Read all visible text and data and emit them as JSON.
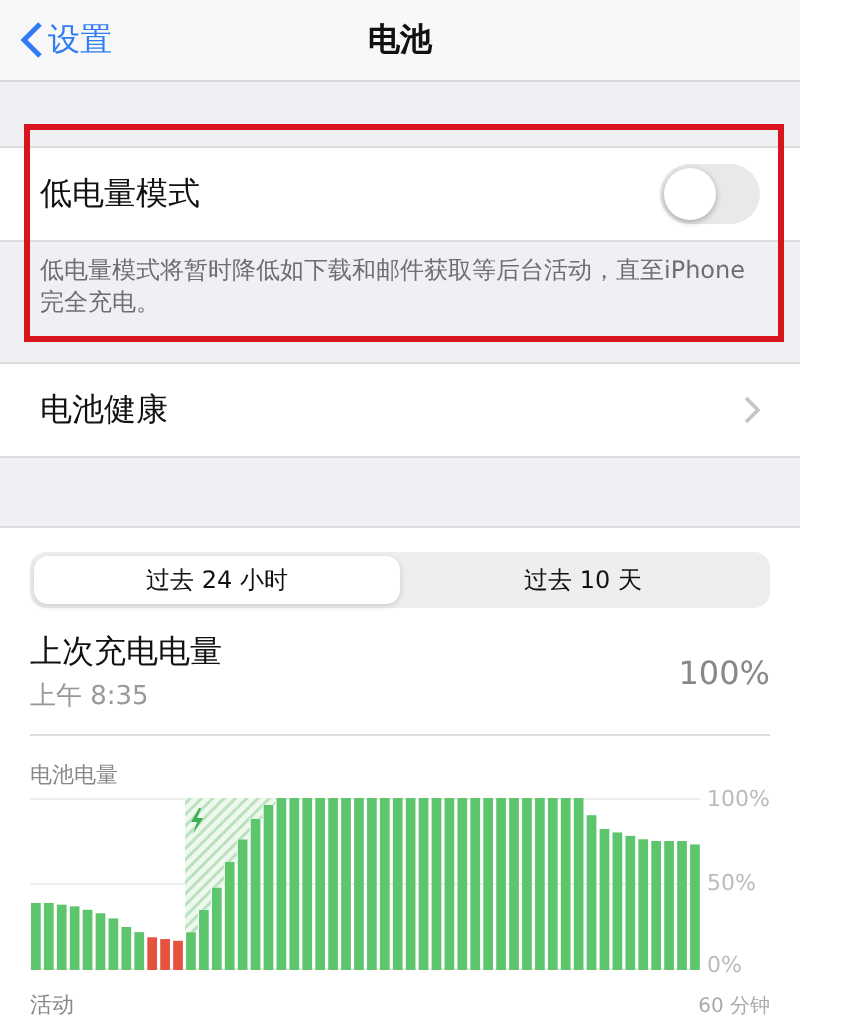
{
  "nav": {
    "back": "设置",
    "title": "电池"
  },
  "low_power": {
    "label": "低电量模式",
    "on": false,
    "description": "低电量模式将暂时降低如下载和邮件获取等后台活动，直至iPhone完全充电。",
    "highlighted": true
  },
  "health": {
    "label": "电池健康"
  },
  "tabs": [
    {
      "label": "过去 24 小时",
      "selected": true
    },
    {
      "label": "过去 10 天",
      "selected": false
    }
  ],
  "last_charge": {
    "label": "上次充电电量",
    "time": "上午 8:35",
    "value": "100%"
  },
  "battery_level": {
    "label": "电池电量",
    "chart_data": {
      "type": "bar",
      "stacked": true,
      "ylim": [
        0,
        100
      ],
      "yticks": [
        {
          "value": 100,
          "label": "100%"
        },
        {
          "value": 50,
          "label": "50%"
        },
        {
          "value": 0,
          "label": "0%"
        }
      ],
      "series": [
        {
          "color": "#5dc56b",
          "values": [
            39,
            39,
            38,
            37,
            35,
            33,
            30,
            25,
            22,
            null,
            null,
            null,
            22,
            35,
            48,
            63,
            76,
            88,
            96,
            100,
            100,
            100,
            100,
            100,
            100,
            100,
            100,
            100,
            100,
            100,
            100,
            100,
            100,
            100,
            100,
            100,
            100,
            100,
            100,
            100,
            100,
            100,
            100,
            90,
            82,
            80,
            78,
            76,
            75,
            75,
            75,
            73
          ]
        },
        {
          "color": "#e5533f",
          "values": [
            null,
            null,
            null,
            null,
            null,
            null,
            null,
            null,
            null,
            19,
            18,
            17,
            null,
            null,
            null,
            null,
            null,
            null,
            null,
            null,
            null,
            null,
            null,
            null,
            null,
            null,
            null,
            null,
            null,
            null,
            null,
            null,
            null,
            null,
            null,
            null,
            null,
            null,
            null,
            null,
            null,
            null,
            null,
            null,
            null,
            null,
            null,
            null,
            null,
            null,
            null,
            null
          ]
        },
        {
          "color": "#b9e2bd",
          "values": [
            null,
            null,
            null,
            null,
            null,
            null,
            null,
            null,
            null,
            null,
            null,
            null,
            78,
            65,
            52,
            37,
            24,
            12,
            4,
            null,
            null,
            null,
            null,
            null,
            null,
            null,
            null,
            null,
            null,
            null,
            null,
            null,
            null,
            null,
            null,
            null,
            null,
            null,
            null,
            null,
            null,
            null,
            null,
            null,
            null,
            null,
            null,
            null,
            null,
            null,
            null,
            null
          ]
        }
      ]
    }
  },
  "activity": {
    "label": "活动",
    "axis_label": "60 分钟"
  }
}
